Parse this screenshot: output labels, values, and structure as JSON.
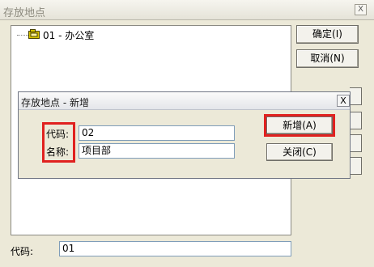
{
  "outer_window": {
    "title": "存放地点",
    "close_glyph": "X",
    "tree": {
      "item_label": "01 - 办公室"
    },
    "buttons": {
      "ok": "确定(I)",
      "cancel": "取消(N)"
    },
    "code_label": "代码:",
    "code_value": "01"
  },
  "dialog": {
    "title": "存放地点 - 新增",
    "close_glyph": "X",
    "code_label": "代码:",
    "code_value": "02",
    "name_label": "名称:",
    "name_value": "项目部",
    "add_button": "新增(A)",
    "close_button": "关闭(C)"
  },
  "colors": {
    "highlight": "#e0211f",
    "folder": "#d8c400"
  }
}
